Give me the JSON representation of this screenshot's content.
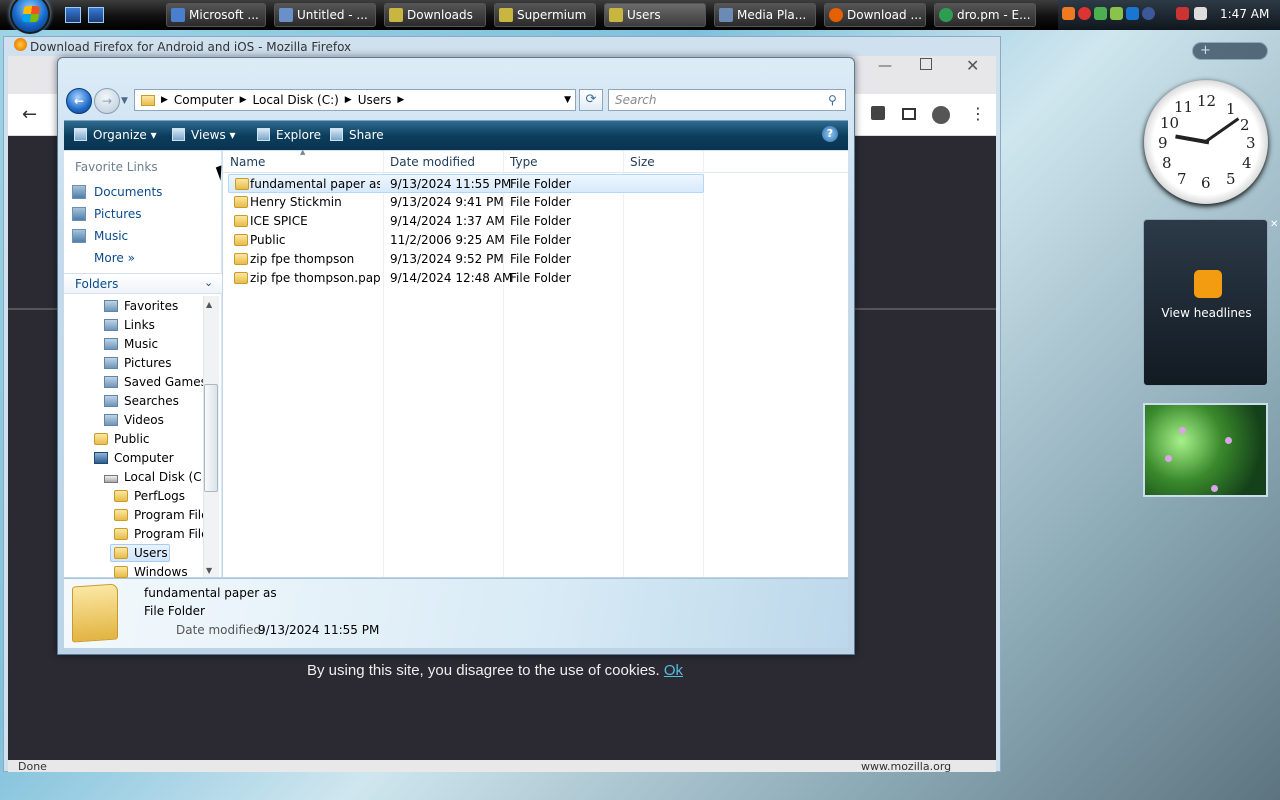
{
  "taskbar": {
    "buttons": [
      {
        "label": "Microsoft ...",
        "color": "#4a7fd0"
      },
      {
        "label": "Untitled - ...",
        "color": "#6a8fc9"
      },
      {
        "label": "Downloads",
        "color": "#c9b640"
      },
      {
        "label": "Supermium",
        "color": "#c9b640"
      },
      {
        "label": "Users",
        "color": "#c9b640"
      },
      {
        "label": "Media Pla...",
        "color": "#6b8bb5"
      },
      {
        "label": "Download ...",
        "color": "#e66000"
      },
      {
        "label": "dro.pm - E...",
        "color": "#2e9d53"
      }
    ],
    "time": "1:47 AM"
  },
  "firefox": {
    "title": "Download Firefox for Android and iOS - Mozilla Firefox",
    "cookie_text": "By using this site, you disagree to the use of cookies.",
    "cookie_link": "Ok",
    "status_left": "Done",
    "status_right": "www.mozilla.org"
  },
  "gadgets": {
    "clock_numbers": [
      "12",
      "1",
      "2",
      "3",
      "4",
      "5",
      "6",
      "7",
      "8",
      "9",
      "10",
      "11"
    ],
    "rss_label": "View headlines",
    "sidebar_add": "+"
  },
  "explorer": {
    "breadcrumb": [
      "Computer",
      "Local Disk (C:)",
      "Users"
    ],
    "search_placeholder": "Search",
    "commands": {
      "organize": "Organize",
      "views": "Views",
      "explore": "Explore",
      "share": "Share"
    },
    "favorite_links_heading": "Favorite Links",
    "favorite_links": [
      "Documents",
      "Pictures",
      "Music"
    ],
    "more_label": "More",
    "folders_heading": "Folders",
    "tree": [
      "Favorites",
      "Links",
      "Music",
      "Pictures",
      "Saved Games",
      "Searches",
      "Videos",
      "Public",
      "Computer",
      "Local Disk (C:)",
      "PerfLogs",
      "Program Files",
      "Program Files",
      "Users",
      "Windows"
    ],
    "columns": {
      "name": "Name",
      "date": "Date modified",
      "type": "Type",
      "size": "Size"
    },
    "files": [
      {
        "name": "fundamental paper as",
        "date": "9/13/2024 11:55 PM",
        "type": "File Folder"
      },
      {
        "name": "Henry Stickmin",
        "date": "9/13/2024 9:41 PM",
        "type": "File Folder"
      },
      {
        "name": "ICE SPICE",
        "date": "9/14/2024 1:37 AM",
        "type": "File Folder"
      },
      {
        "name": "Public",
        "date": "11/2/2006 9:25 AM",
        "type": "File Folder"
      },
      {
        "name": "zip fpe thompson",
        "date": "9/13/2024 9:52 PM",
        "type": "File Folder"
      },
      {
        "name": "zip fpe thompson.pap...",
        "date": "9/14/2024 12:48 AM",
        "type": "File Folder"
      }
    ],
    "details": {
      "name": "fundamental paper as",
      "type": "File Folder",
      "modified_label": "Date modified:",
      "modified_value": "9/13/2024 11:55 PM"
    }
  }
}
